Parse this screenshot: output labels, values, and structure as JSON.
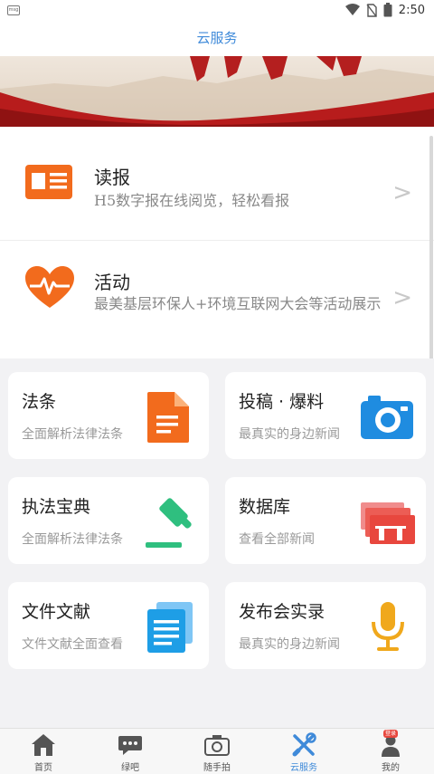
{
  "status": {
    "time": "2:50",
    "sim_label": "msg"
  },
  "title": "云服务",
  "list": [
    {
      "title": "读报",
      "subtitle": "H5数字报在线阅览，轻松看报",
      "icon": "newspaper-icon"
    },
    {
      "title": "活动",
      "subtitle": "最美基层环保人+环境互联网大会等活动展示",
      "icon": "heart-pulse-icon"
    }
  ],
  "cards": [
    {
      "title": "法条",
      "subtitle": "全面解析法律法条",
      "icon": "document-icon"
    },
    {
      "title": "投稿 · 爆料",
      "subtitle": "最真实的身边新闻",
      "icon": "camera-icon"
    },
    {
      "title": "执法宝典",
      "subtitle": "全面解析法律法条",
      "icon": "gavel-icon"
    },
    {
      "title": "数据库",
      "subtitle": "查看全部新闻",
      "icon": "database-icon"
    },
    {
      "title": "文件文献",
      "subtitle": "文件文献全面查看",
      "icon": "files-icon"
    },
    {
      "title": "发布会实录",
      "subtitle": "最真实的身边新闻",
      "icon": "microphone-icon"
    }
  ],
  "tabs": [
    {
      "label": "首页",
      "icon": "home-icon"
    },
    {
      "label": "绿吧",
      "icon": "chat-icon"
    },
    {
      "label": "随手拍",
      "icon": "camera-icon"
    },
    {
      "label": "云服务",
      "icon": "tools-icon",
      "active": true
    },
    {
      "label": "我的",
      "icon": "user-icon",
      "badge": "登录"
    }
  ],
  "colors": {
    "accent": "#3f8ad9",
    "orange": "#f26b1d",
    "green": "#2fbf7f",
    "red": "#e8473e",
    "blue": "#1f8ce0",
    "gold": "#f0a81c"
  }
}
